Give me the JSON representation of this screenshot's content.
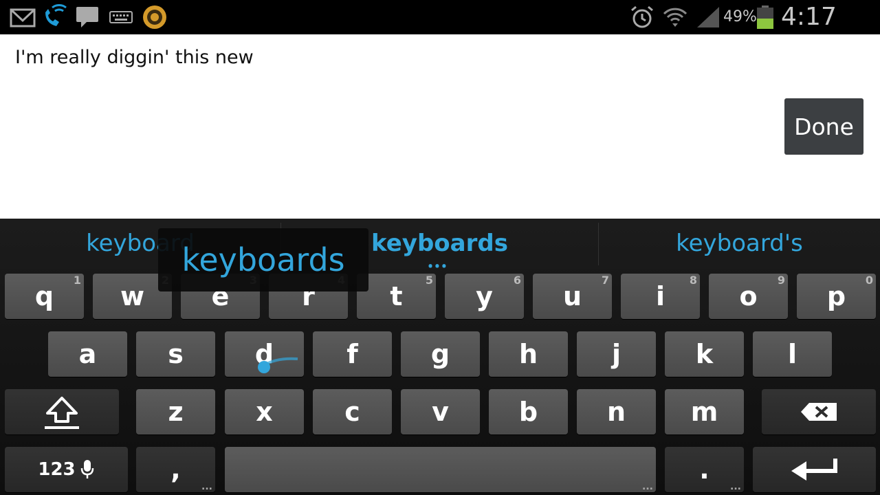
{
  "status_bar": {
    "icons_left": [
      "gmail-icon",
      "wifi-calling-icon",
      "messaging-icon",
      "keyboard-icon",
      "app-ring-icon"
    ],
    "icons_right": [
      "alarm-icon",
      "wifi-icon",
      "signal-icon",
      "battery-icon"
    ],
    "battery_percent": "49%",
    "time": "4:17 PM",
    "battery_level": 0.49
  },
  "editor": {
    "text": "I'm really diggin' this new",
    "done_label": "Done"
  },
  "suggestions": {
    "items": [
      "keyboard",
      "keyboards",
      "keyboard's"
    ],
    "preview": "keyboards",
    "more_dots": "•••"
  },
  "keyboard": {
    "row1": [
      {
        "label": "q",
        "hint": "1"
      },
      {
        "label": "w",
        "hint": "2"
      },
      {
        "label": "e",
        "hint": "3"
      },
      {
        "label": "r",
        "hint": "4"
      },
      {
        "label": "t",
        "hint": "5"
      },
      {
        "label": "y",
        "hint": "6"
      },
      {
        "label": "u",
        "hint": "7"
      },
      {
        "label": "i",
        "hint": "8"
      },
      {
        "label": "o",
        "hint": "9"
      },
      {
        "label": "p",
        "hint": "0"
      }
    ],
    "row2": [
      "a",
      "s",
      "d",
      "f",
      "g",
      "h",
      "j",
      "k",
      "l"
    ],
    "row3": [
      "z",
      "x",
      "c",
      "v",
      "b",
      "n",
      "m"
    ],
    "symbols_label": "123",
    "comma_label": ",",
    "period_label": ".",
    "ellipsis": "..."
  },
  "colors": {
    "accent": "#33a6dc",
    "battery_fill": "#8dc63f"
  }
}
